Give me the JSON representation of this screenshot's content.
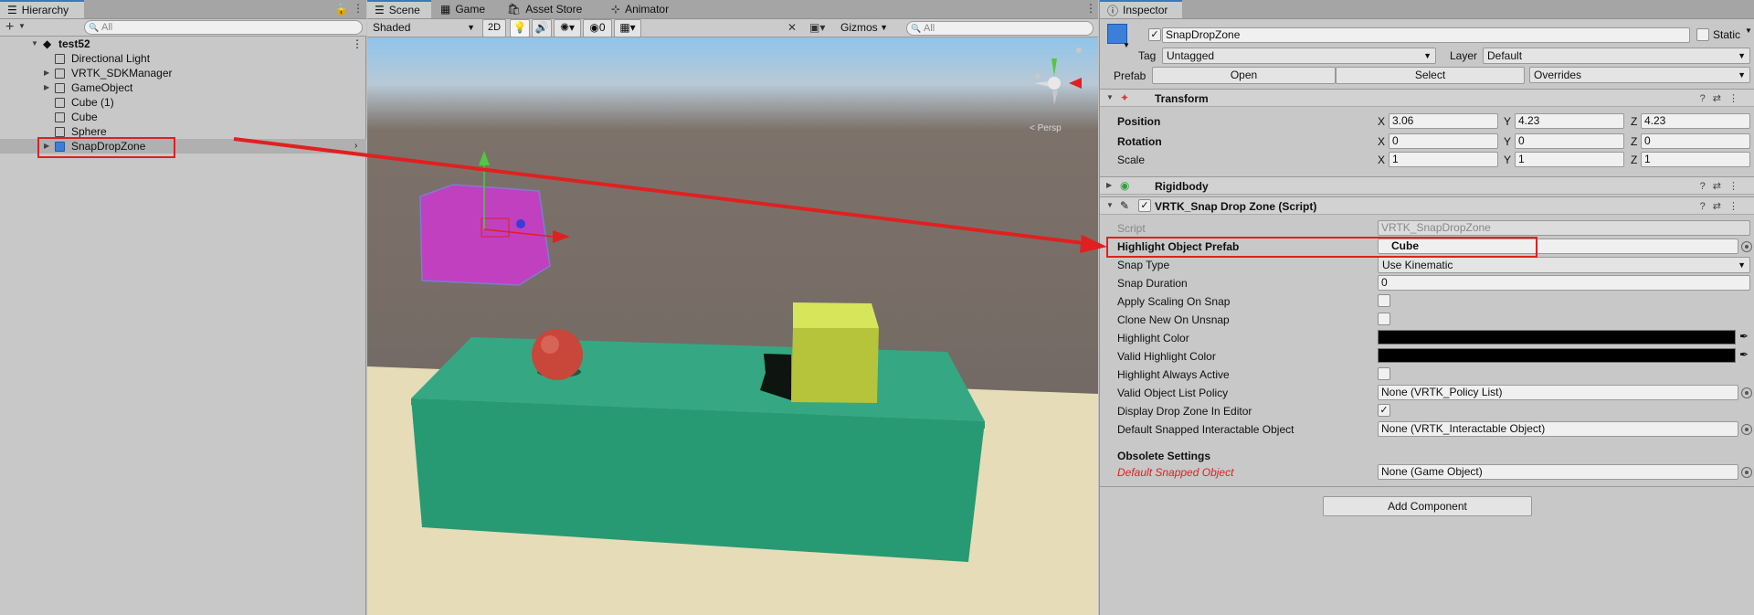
{
  "hierarchy": {
    "tab_label": "Hierarchy",
    "add_label": "+",
    "search_placeholder": "All",
    "scene_name": "test52",
    "items": [
      {
        "label": "Directional Light",
        "foldable": false
      },
      {
        "label": "VRTK_SDKManager",
        "foldable": true
      },
      {
        "label": "GameObject",
        "foldable": true
      },
      {
        "label": "Cube (1)",
        "foldable": false
      },
      {
        "label": "Cube",
        "foldable": false
      },
      {
        "label": "Sphere",
        "foldable": false
      },
      {
        "label": "SnapDropZone",
        "foldable": true,
        "selected": true
      }
    ]
  },
  "scene": {
    "tabs": [
      {
        "label": "Scene",
        "icon": "scene-icon",
        "active": true
      },
      {
        "label": "Game",
        "icon": "game-icon",
        "active": false
      },
      {
        "label": "Asset Store",
        "icon": "asset-store-icon",
        "active": false
      },
      {
        "label": "Animator",
        "icon": "animator-icon",
        "active": false
      }
    ],
    "shading_mode": "Shaded",
    "mode_2d": "2D",
    "hidden_count": "0",
    "gizmos_label": "Gizmos",
    "search_placeholder": "All",
    "persp_label": "< Persp"
  },
  "inspector": {
    "tab_label": "Inspector",
    "object_name": "SnapDropZone",
    "static_label": "Static",
    "tag_label": "Tag",
    "tag_value": "Untagged",
    "layer_label": "Layer",
    "layer_value": "Default",
    "prefab_label": "Prefab",
    "open_label": "Open",
    "select_label": "Select",
    "overrides_label": "Overrides",
    "transform": {
      "title": "Transform",
      "position_label": "Position",
      "rotation_label": "Rotation",
      "scale_label": "Scale",
      "position": {
        "x": "3.06",
        "y": "4.23",
        "z": "4.23"
      },
      "rotation": {
        "x": "0",
        "y": "0",
        "z": "0"
      },
      "scale": {
        "x": "1",
        "y": "1",
        "z": "1"
      }
    },
    "rigidbody_title": "Rigidbody",
    "snap_script": {
      "title": "VRTK_Snap Drop Zone (Script)",
      "script_label": "Script",
      "script_value": "VRTK_SnapDropZone",
      "highlight_prefab_label": "Highlight Object Prefab",
      "highlight_prefab_value": "Cube",
      "snap_type_label": "Snap Type",
      "snap_type_value": "Use Kinematic",
      "snap_duration_label": "Snap Duration",
      "snap_duration_value": "0",
      "apply_scaling_label": "Apply Scaling On Snap",
      "clone_new_label": "Clone New On Unsnap",
      "highlight_color_label": "Highlight Color",
      "valid_highlight_color_label": "Valid Highlight Color",
      "highlight_always_label": "Highlight Always Active",
      "valid_policy_label": "Valid Object List Policy",
      "valid_policy_value": "None (VRTK_Policy List)",
      "display_drop_zone_label": "Display Drop Zone In Editor",
      "default_snapped_label": "Default Snapped Interactable Object",
      "default_snapped_value": "None (VRTK_Interactable Object)",
      "obsolete_label": "Obsolete Settings",
      "default_snapped_obj_label": "Default Snapped Object",
      "default_snapped_obj_value": "None (Game Object)"
    },
    "add_component_label": "Add Component"
  },
  "colors": {
    "selection": "#3b7fd8",
    "annotation_red": "#e02020",
    "obsolete_red": "#e02020",
    "sky_top": "#8fc4ea",
    "ground": "#e6dcb8",
    "table": "#2a9a76",
    "cube": "#b5c43a",
    "sphere": "#c8463a",
    "zone": "#c040c0"
  }
}
